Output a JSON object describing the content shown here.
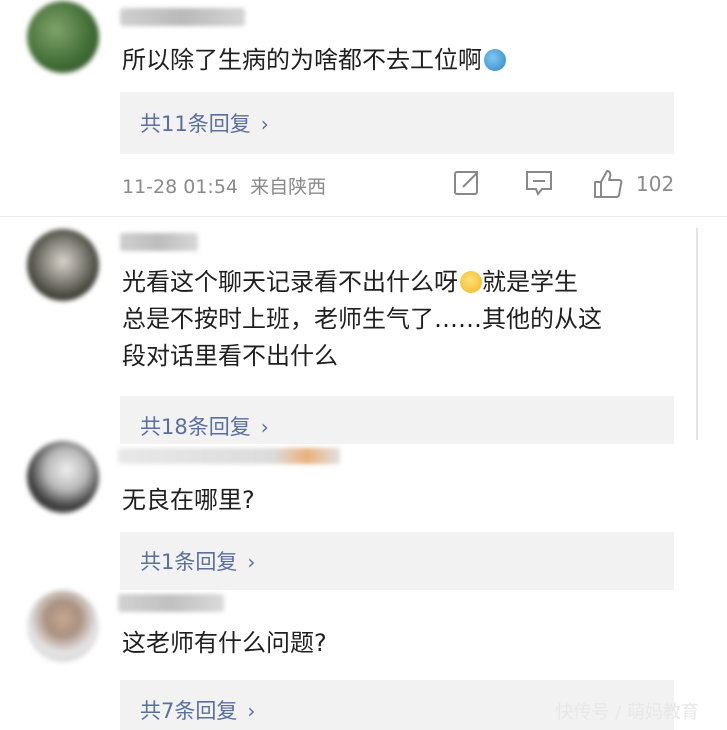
{
  "comments": [
    {
      "text_lines": [
        "所以除了生病的为啥都不去工位啊"
      ],
      "reply_label": "共11条回复",
      "chevron": "›",
      "meta": {
        "time": "11-28 01:54",
        "location": "来自陕西",
        "likes": "102"
      }
    },
    {
      "text_lines": [
        "光看这个聊天记录看不出什么呀",
        "就是学生",
        "总是不按时上班，老师生气了……其他的从这",
        "段对话里看不出什么"
      ],
      "reply_label": "共18条回复",
      "chevron": "›"
    },
    {
      "text_lines": [
        "无良在哪里?"
      ],
      "reply_label": "共1条回复",
      "chevron": "›"
    },
    {
      "text_lines": [
        "这老师有什么问题?"
      ],
      "reply_label": "共7条回复",
      "chevron": "›"
    }
  ],
  "icons": [
    "share-icon",
    "comment-icon",
    "like-icon",
    "emoji-icon",
    "laugh-cry-emoji-icon"
  ],
  "watermark": "快传号 / 萌妈教育",
  "colors": {
    "reply_text": "#5a6f9c",
    "reply_bg": "#f2f2f2",
    "meta": "#8a8a8a"
  }
}
